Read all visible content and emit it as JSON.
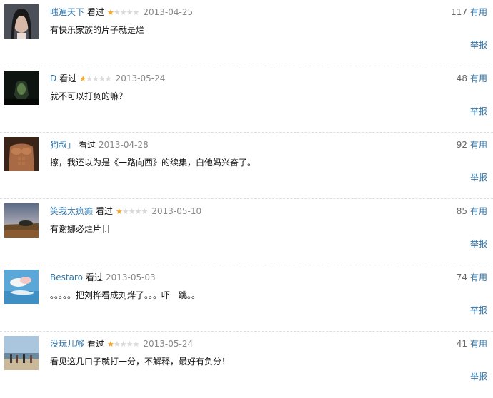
{
  "comments": [
    {
      "user": "嗤遍天下",
      "watched": "看过",
      "rating": 1,
      "rating_max": 5,
      "date": "2013-04-25",
      "text": "有快乐家族的片子就是烂",
      "votes": "117",
      "useful_label": "有用",
      "report_label": "举报",
      "avatar_icon": "portrait-woman-dark-hair"
    },
    {
      "user": "D",
      "watched": "看过",
      "rating": 1,
      "rating_max": 5,
      "date": "2013-05-24",
      "text": "就不可以打负的嘛？",
      "votes": "48",
      "useful_label": "有用",
      "report_label": "举报",
      "avatar_icon": "dark-figure"
    },
    {
      "user": "狗叔」",
      "watched": "看过",
      "rating": null,
      "rating_max": 5,
      "date": "2013-04-28",
      "text": "擦，我还以为是《一路向西》的续集，白他妈兴奋了。",
      "votes": "92",
      "useful_label": "有用",
      "report_label": "举报",
      "avatar_icon": "muscular-torso"
    },
    {
      "user": "笑我太疯癫",
      "watched": "看过",
      "rating": 1,
      "rating_max": 5,
      "date": "2013-05-10",
      "text": "有谢娜必烂片",
      "text_icon": "phone-icon",
      "votes": "85",
      "useful_label": "有用",
      "report_label": "举报",
      "avatar_icon": "sunset-landscape"
    },
    {
      "user": "Bestaro",
      "watched": "看过",
      "rating": null,
      "rating_max": 5,
      "date": "2013-05-03",
      "text": "。。。。。把刘桦看成刘烨了。。。吓一跳。。",
      "votes": "74",
      "useful_label": "有用",
      "report_label": "举报",
      "avatar_icon": "whale-cloud-sky"
    },
    {
      "user": "没玩儿够",
      "watched": "看过",
      "rating": 1,
      "rating_max": 5,
      "date": "2013-05-24",
      "text": "看见这几口子就打一分，不解释，最好有负分！",
      "votes": "41",
      "useful_label": "有用",
      "report_label": "举报",
      "avatar_icon": "beach-people"
    }
  ],
  "colors": {
    "link": "#3377aa",
    "star_on": "#f5a623",
    "star_off": "#d9d9d9",
    "date": "#888888",
    "divider": "#dddddd"
  }
}
